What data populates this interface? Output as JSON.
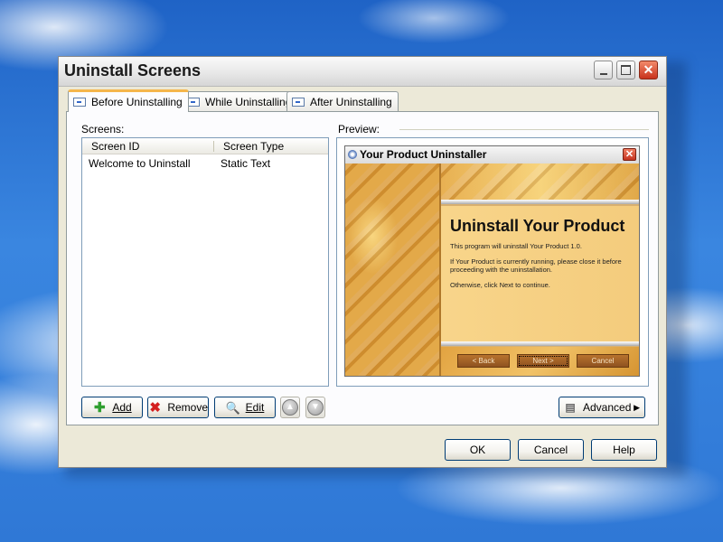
{
  "window": {
    "title": "Uninstall Screens"
  },
  "tabs": [
    {
      "label": "Before Uninstalling",
      "active": true
    },
    {
      "label": "While Uninstalling",
      "active": false
    },
    {
      "label": "After Uninstalling",
      "active": false
    }
  ],
  "screens": {
    "label": "Screens:",
    "columns": [
      "Screen ID",
      "Screen Type"
    ],
    "rows": [
      {
        "id": "Welcome to Uninstall",
        "type": "Static Text"
      }
    ]
  },
  "preview": {
    "label": "Preview:",
    "window_title": "Your Product Uninstaller",
    "heading": "Uninstall Your Product",
    "paragraphs": [
      "This program will uninstall Your Product 1.0.",
      "If Your Product is currently running, please close it before proceeding with the uninstallation.",
      "Otherwise, click Next to continue."
    ],
    "buttons": {
      "back": "< Back",
      "next": "Next >",
      "cancel": "Cancel"
    }
  },
  "actions": {
    "add": "Add",
    "remove": "Remove",
    "edit": "Edit",
    "advanced": "Advanced"
  },
  "dialog_buttons": {
    "ok": "OK",
    "cancel": "Cancel",
    "help": "Help"
  },
  "colors": {
    "tab_accent": "#f5b64c",
    "close_red": "#c8321c",
    "add_green": "#2e9e2e",
    "remove_red": "#d42020"
  }
}
